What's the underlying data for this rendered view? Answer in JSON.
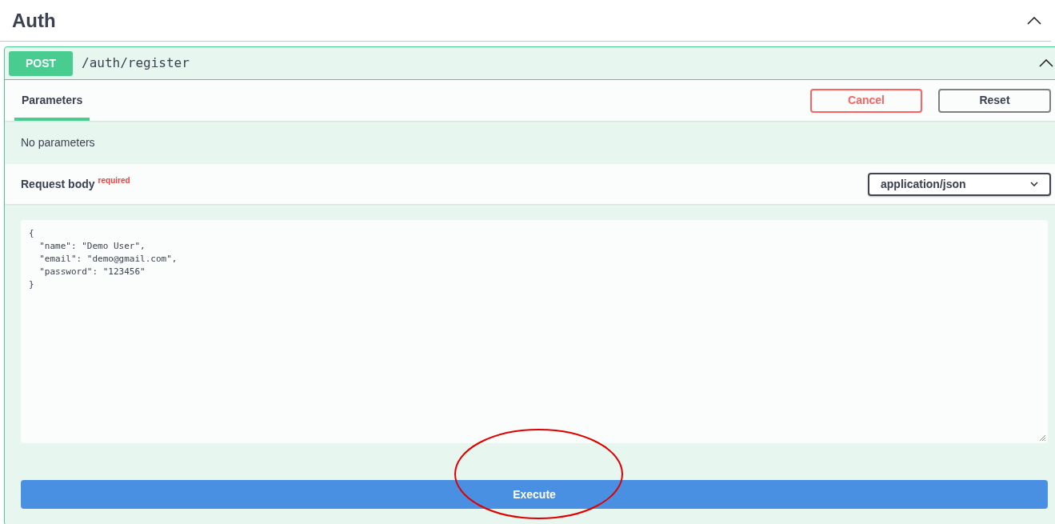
{
  "section": {
    "title": "Auth",
    "expanded": true
  },
  "operation": {
    "method": "POST",
    "path": "/auth/register",
    "expanded": true
  },
  "tabs": [
    {
      "label": "Parameters",
      "selected": true
    }
  ],
  "buttons": [
    {
      "label": "Cancel",
      "kind": "cancel"
    },
    {
      "label": "Reset",
      "kind": "reset"
    }
  ],
  "parameters_message": "No parameters",
  "request_body": {
    "label": "Request body",
    "required_label": "required",
    "content_type": "application/json",
    "value": "{\n  \"name\": \"Demo User\",\n  \"email\": \"demo@gmail.com\",\n  \"password\": \"123456\"\n}"
  },
  "execute_button": "Execute"
}
